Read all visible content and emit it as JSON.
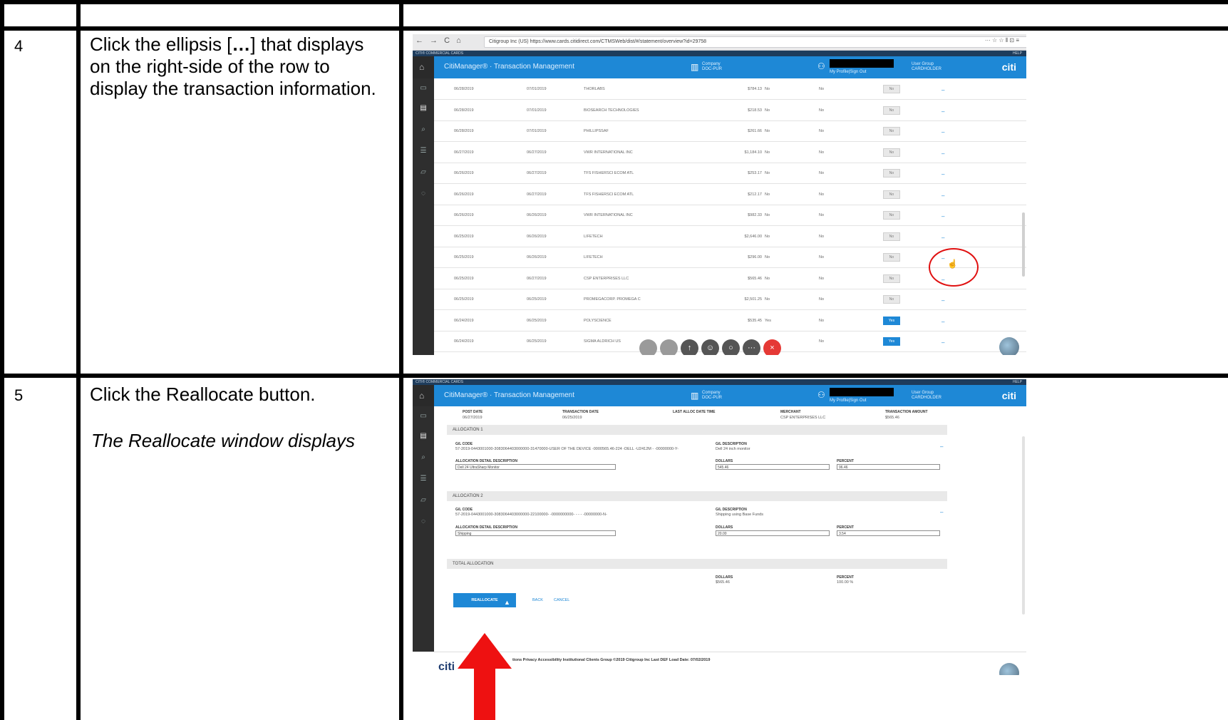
{
  "steps": [
    {
      "number": "4",
      "instruction_pre": "Click the ellipsis [",
      "instruction_bold": "…",
      "instruction_post": "] that displays on the right-side of the row to display the transaction information."
    },
    {
      "number": "5",
      "instruction": "Click the Reallocate button.",
      "note": "The Reallocate window displays"
    }
  ],
  "app": {
    "title": "CitiManager® · Transaction Management",
    "company_label": "Company",
    "company_value": "DOC-PUR",
    "user_link": "My Profile|Sign Out",
    "user_group_label": "User Group",
    "user_group_value": "CARDHOLDER",
    "logo": "citi",
    "strip_text": "CITI® COMMERCIAL CARDS",
    "strip_help": "HELP"
  },
  "browser": {
    "nav_icons": "← → C ⌂",
    "url": "Citigroup Inc (US)   https://www.cards.citidirect.com/CTMSWeb/dist/#/statement/overview?id=29758",
    "right_icons": "··· ☆ ☆          ⫴ ⊡ ≡"
  },
  "sidebar_icons": [
    "home-icon",
    "card-icon",
    "document-icon",
    "search-icon",
    "stack-icon",
    "folder-icon",
    "bell-icon"
  ],
  "transactions": [
    {
      "post": "06/28/2019",
      "trans": "07/01/2019",
      "merchant": "THORLABS",
      "amount": "$784.13",
      "disputed": "No",
      "col2": "No",
      "toggle": "No"
    },
    {
      "post": "06/28/2019",
      "trans": "07/01/2019",
      "merchant": "BIOSEARCH TECHNOLOGIES",
      "amount": "$218.53",
      "disputed": "No",
      "col2": "No",
      "toggle": "No"
    },
    {
      "post": "06/28/2019",
      "trans": "07/01/2019",
      "merchant": "PHILLIPSSAF",
      "amount": "$261.66",
      "disputed": "No",
      "col2": "No",
      "toggle": "No"
    },
    {
      "post": "06/27/2019",
      "trans": "06/27/2019",
      "merchant": "VWR INTERNATIONAL INC",
      "amount": "$1,184.10",
      "disputed": "No",
      "col2": "No",
      "toggle": "No"
    },
    {
      "post": "06/26/2019",
      "trans": "06/27/2019",
      "merchant": "TFS FISHERSCI ECOM ATL",
      "amount": "$253.17",
      "disputed": "No",
      "col2": "No",
      "toggle": "No"
    },
    {
      "post": "06/26/2019",
      "trans": "06/27/2019",
      "merchant": "TFS FISHERSCI ECOM ATL",
      "amount": "$212.17",
      "disputed": "No",
      "col2": "No",
      "toggle": "No"
    },
    {
      "post": "06/26/2019",
      "trans": "06/26/2019",
      "merchant": "VWR INTERNATIONAL INC",
      "amount": "$982.33",
      "disputed": "No",
      "col2": "No",
      "toggle": "No"
    },
    {
      "post": "06/25/2019",
      "trans": "06/26/2019",
      "merchant": "LIFETECH",
      "amount": "$2,646.00",
      "disputed": "No",
      "col2": "No",
      "toggle": "No"
    },
    {
      "post": "06/25/2019",
      "trans": "06/26/2019",
      "merchant": "LIFETECH",
      "amount": "$296.00",
      "disputed": "No",
      "col2": "No",
      "toggle": "No"
    },
    {
      "post": "06/25/2019",
      "trans": "06/27/2019",
      "merchant": "CSP ENTERPRISES LLC",
      "amount": "$565.46",
      "disputed": "No",
      "col2": "No",
      "toggle": "No"
    },
    {
      "post": "06/25/2019",
      "trans": "06/25/2019",
      "merchant": "PROMEGACORP. PROMEGA C",
      "amount": "$2,501.25",
      "disputed": "No",
      "col2": "No",
      "toggle": "No"
    },
    {
      "post": "06/24/2019",
      "trans": "06/25/2019",
      "merchant": "POLYSCIENCE",
      "amount": "$535.45",
      "disputed": "Yes",
      "col2": "No",
      "toggle": "Yes"
    },
    {
      "post": "06/24/2019",
      "trans": "06/25/2019",
      "merchant": "SIGMA ALDRICH US",
      "amount": "",
      "disputed": "",
      "col2": "No",
      "toggle": "Yes"
    }
  ],
  "details": {
    "post_date_label": "POST DATE",
    "post_date": "06/27/2019",
    "trans_date_label": "TRANSACTION DATE",
    "trans_date": "06/25/2019",
    "last_alloc_label": "LAST ALLOC DATE TIME",
    "merchant_label": "MERCHANT",
    "merchant": "CSP ENTERPRISES LLC",
    "amount_label": "TRANSACTION AMOUNT",
    "amount": "$565.46"
  },
  "allocations": [
    {
      "title": "ALLOCATION 1",
      "gl_code_label": "G/L CODE",
      "gl_code": "57-2019-0443001000-3083064403000000-31470000-USER OF THE DEVICE -0000565.46-224 -DELL -U2412M - -00000000-Y-",
      "gl_desc_label": "G/L DESCRIPTION",
      "gl_desc": "Dell 24 inch monitor",
      "detail_label": "ALLOCATION DETAIL DESCRIPTION",
      "detail": "Dell 24 UltraSharp Monitor",
      "dollars_label": "DOLLARS",
      "dollars": "545.46",
      "percent_label": "PERCENT",
      "percent": "96.46"
    },
    {
      "title": "ALLOCATION 2",
      "gl_code_label": "G/L CODE",
      "gl_code": "57-2019-0443001000-3083064403000000-22100000- -0000000000- - - - -00000000-N-",
      "gl_desc_label": "G/L DESCRIPTION",
      "gl_desc": "Shipping using Base Funds",
      "detail_label": "ALLOCATION DETAIL DESCRIPTION",
      "detail": "Shipping",
      "dollars_label": "DOLLARS",
      "dollars": "20.00",
      "percent_label": "PERCENT",
      "percent": "3.54"
    }
  ],
  "total": {
    "title": "TOTAL ALLOCATION",
    "dollars_label": "DOLLARS",
    "dollars": "$565.46",
    "percent_label": "PERCENT",
    "percent": "100.00 %"
  },
  "actions": {
    "reallocate": "REALLOCATE",
    "back": "BACK",
    "cancel": "CANCEL"
  },
  "footer": {
    "text": "tions   Privacy   Accessibility   Institutional Clients Group   ©2019 Citigroup Inc   Last DEF Load Date: 07/02/2019",
    "logo": "citi"
  },
  "colors": {
    "header_blue": "#1e88d6",
    "annotation_red": "#e01010"
  }
}
